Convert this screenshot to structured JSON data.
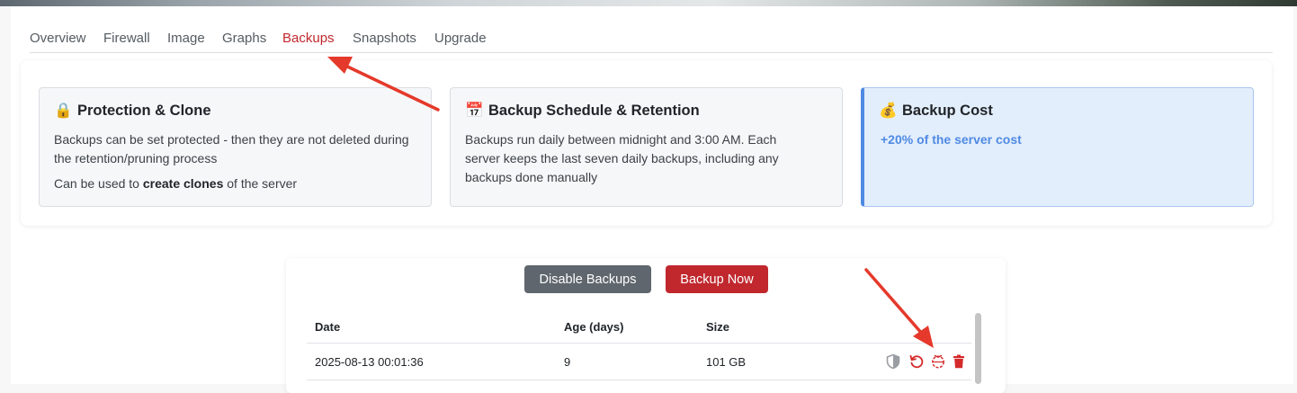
{
  "tabs": [
    {
      "label": "Overview",
      "active": false
    },
    {
      "label": "Firewall",
      "active": false
    },
    {
      "label": "Image",
      "active": false
    },
    {
      "label": "Graphs",
      "active": false
    },
    {
      "label": "Backups",
      "active": true
    },
    {
      "label": "Snapshots",
      "active": false
    },
    {
      "label": "Upgrade",
      "active": false
    }
  ],
  "cards": {
    "protection": {
      "icon": "🔒",
      "title": "Protection & Clone",
      "text": "Backups can be set protected - then they are not deleted during the retention/pruning process",
      "text2_prefix": "Can be used to ",
      "text2_bold": "create clones",
      "text2_suffix": " of the server"
    },
    "schedule": {
      "icon": "📅",
      "title": "Backup Schedule & Retention",
      "text": "Backups run daily between midnight and 3:00 AM. Each server keeps the last seven daily backups, including any backups done manually"
    },
    "cost": {
      "icon": "💰",
      "title": "Backup Cost",
      "text": "+20% of the server cost"
    }
  },
  "buttons": {
    "disable": "Disable Backups",
    "now": "Backup Now"
  },
  "table": {
    "headers": [
      "Date",
      "Age (days)",
      "Size"
    ],
    "rows": [
      {
        "date": "2025-08-13 00:01:36",
        "age": "9",
        "size": "101 GB"
      }
    ],
    "row_actions": [
      "shield-icon",
      "restore-icon",
      "clone-icon",
      "trash-icon"
    ]
  },
  "colors": {
    "accent": "#c0282e",
    "info_blue": "#4f8ae4",
    "secondary": "#5f666d",
    "annotation_arrow": "#e5392b"
  }
}
